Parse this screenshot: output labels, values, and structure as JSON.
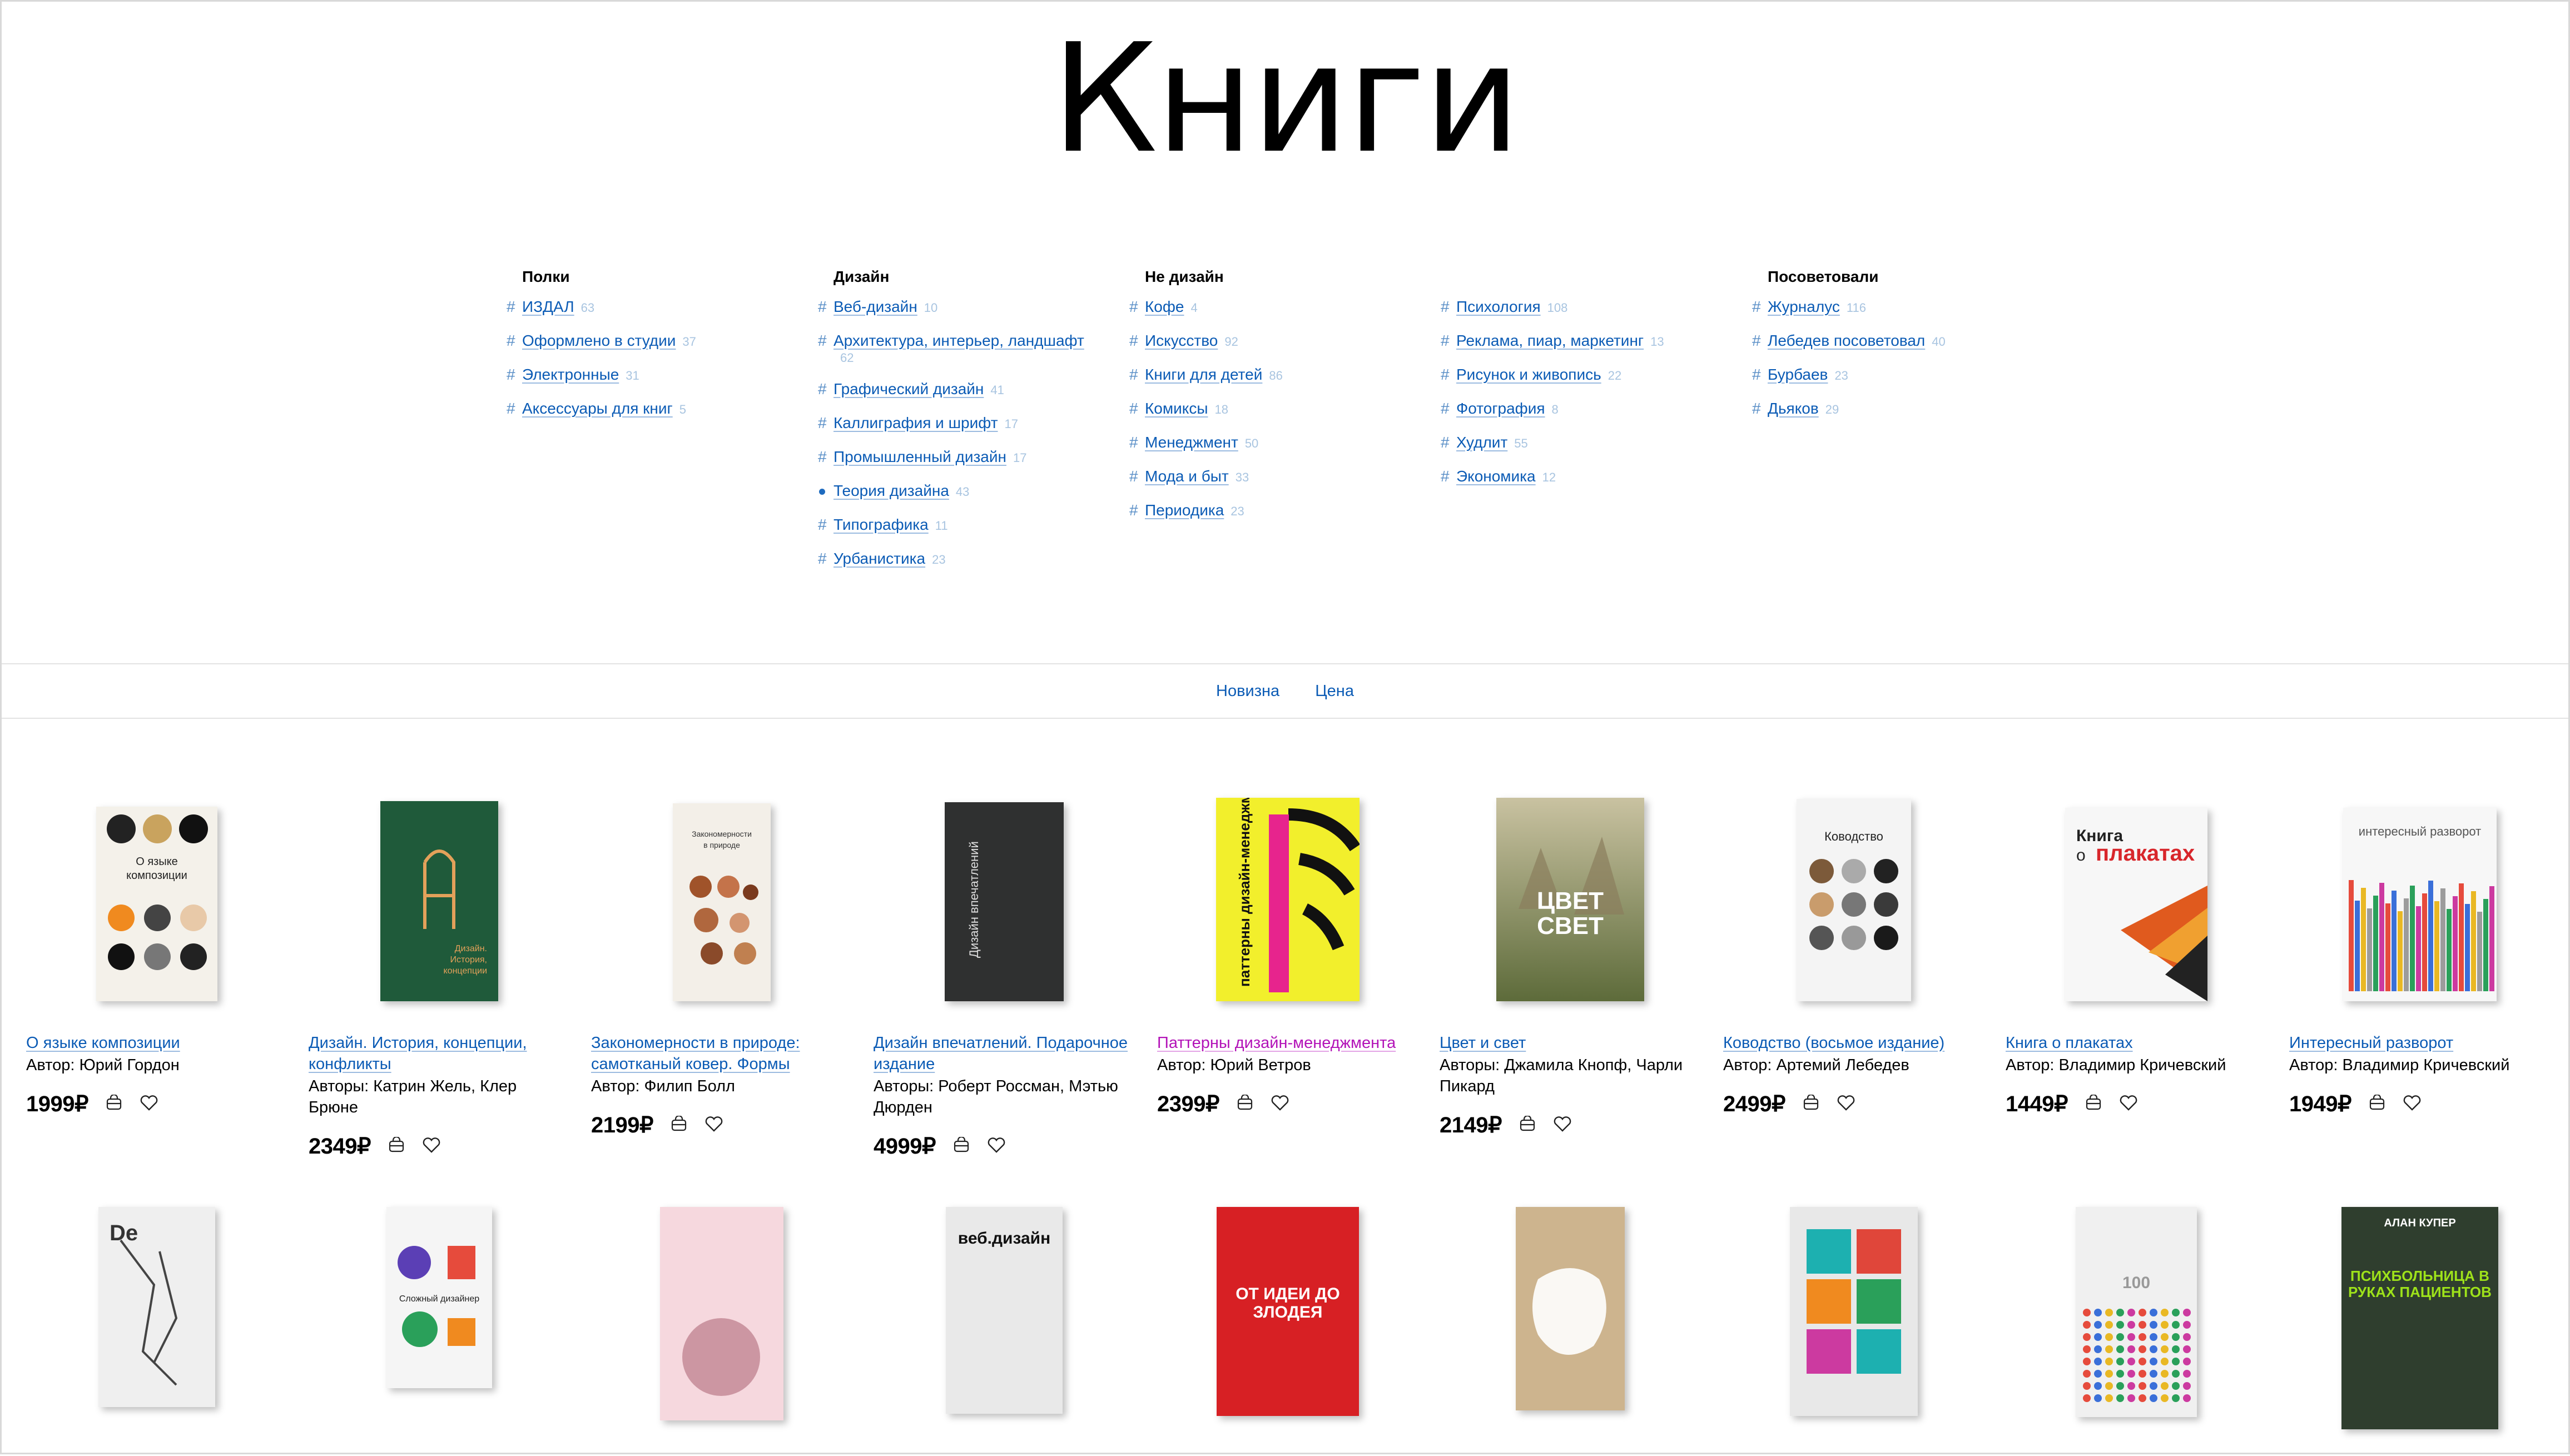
{
  "page": {
    "title": "Книги"
  },
  "categories": [
    {
      "heading": "Полки",
      "items": [
        {
          "label": "ИЗДАЛ",
          "count": "63"
        },
        {
          "label": "Оформлено в студии",
          "count": "37"
        },
        {
          "label": "Электронные",
          "count": "31"
        },
        {
          "label": "Аксессуары для книг",
          "count": "5"
        }
      ]
    },
    {
      "heading": "Дизайн",
      "items": [
        {
          "label": "Веб-дизайн",
          "count": "10"
        },
        {
          "label": "Архитектура, интерьер, ландшафт",
          "count": "62"
        },
        {
          "label": "Графический дизайн",
          "count": "41"
        },
        {
          "label": "Каллиграфия и шрифт",
          "count": "17"
        },
        {
          "label": "Промышленный дизайн",
          "count": "17"
        },
        {
          "label": "Теория дизайна",
          "count": "43",
          "active": true
        },
        {
          "label": "Типографика",
          "count": "11"
        },
        {
          "label": "Урбанистика",
          "count": "23"
        }
      ]
    },
    {
      "heading": "Не дизайн",
      "items": [
        {
          "label": "Кофе",
          "count": "4"
        },
        {
          "label": "Искусство",
          "count": "92"
        },
        {
          "label": "Книги для детей",
          "count": "86"
        },
        {
          "label": "Комиксы",
          "count": "18"
        },
        {
          "label": "Менеджмент",
          "count": "50"
        },
        {
          "label": "Мода и быт",
          "count": "33"
        },
        {
          "label": "Периодика",
          "count": "23"
        }
      ]
    },
    {
      "heading": "",
      "items": [
        {
          "label": "Психология",
          "count": "108"
        },
        {
          "label": "Реклама, пиар, маркетинг",
          "count": "13"
        },
        {
          "label": "Рисунок и живопись",
          "count": "22"
        },
        {
          "label": "Фотография",
          "count": "8"
        },
        {
          "label": "Худлит",
          "count": "55"
        },
        {
          "label": "Экономика",
          "count": "12"
        }
      ]
    },
    {
      "heading": "Посоветовали",
      "items": [
        {
          "label": "Журналус",
          "count": "116"
        },
        {
          "label": "Лебедев посоветовал",
          "count": "40"
        },
        {
          "label": "Бурбаев",
          "count": "23"
        },
        {
          "label": "Дьяков",
          "count": "29"
        }
      ]
    }
  ],
  "sort": {
    "newest": "Новизна",
    "price": "Цена"
  },
  "products": [
    {
      "title": "О языке композиции",
      "author": "Автор: Юрий Гордон",
      "price": "1999₽",
      "cover_bg": "#f4f1ea",
      "cover_fg": "#222"
    },
    {
      "title": "Дизайн. История, концепции, конфликты",
      "author": "Авторы: Катрин Жель, Клер Брюне",
      "price": "2349₽",
      "cover_bg": "#1f5a3a",
      "cover_fg": "#e3a15a"
    },
    {
      "title": "Закономерности в природе: самотканый ковер. Формы",
      "author": "Автор: Филип Болл",
      "price": "2199₽",
      "cover_bg": "#f3efe8",
      "cover_fg": "#7a3a1e"
    },
    {
      "title": "Дизайн впечатлений. Подарочное издание",
      "author": "Авторы: Роберт Россман, Мэтью Дюрден",
      "price": "4999₽",
      "cover_bg": "#2f3030",
      "cover_fg": "#ddd"
    },
    {
      "title": "Паттерны дизайн-менеджмента",
      "author": "Автор: Юрий Ветров",
      "price": "2399₽",
      "cover_bg": "#f2ef2c",
      "cover_fg": "#111",
      "pink": true
    },
    {
      "title": "Цвет и свет",
      "author": "Авторы: Джамила Кнопф, Чарли Пикард",
      "price": "2149₽",
      "cover_bg": "#7b7a63",
      "cover_fg": "#fff"
    },
    {
      "title": "Ководство (восьмое издание)",
      "author": "Автор: Артемий Лебедев",
      "price": "2499₽",
      "cover_bg": "#f4f4f4",
      "cover_fg": "#222"
    },
    {
      "title": "Книга о плакатах",
      "author": "Автор: Владимир Кричевский",
      "price": "1449₽",
      "cover_bg": "#f7f7f7",
      "cover_fg": "#d8262b"
    },
    {
      "title": "Интересный разворот",
      "author": "Автор: Владимир Кричевский",
      "price": "1949₽",
      "cover_bg": "#f7f7f7",
      "cover_fg": "#c42"
    }
  ],
  "products_row2": [
    {
      "cover_bg": "#efefef",
      "cover_fg": "#222"
    },
    {
      "cover_bg": "#f5f5f5",
      "cover_fg": "#5b3fb5"
    },
    {
      "cover_bg": "#f6d8de",
      "cover_fg": "#c05a74"
    },
    {
      "cover_bg": "#e9e9e9",
      "cover_fg": "#111",
      "label": "веб.дизайн"
    },
    {
      "cover_bg": "#d72024",
      "cover_fg": "#fff",
      "label": "ОТ ИДЕИ ДО ЗЛОДЕЯ"
    },
    {
      "cover_bg": "#cdb48e",
      "cover_fg": "#fff"
    },
    {
      "cover_bg": "#e8e8e8",
      "cover_fg": "#e0463a"
    },
    {
      "cover_bg": "#f0f0f0",
      "cover_fg": "#999",
      "label": "100"
    },
    {
      "cover_bg": "#2f3e2e",
      "cover_fg": "#9ee21a",
      "label": "ПСИХБОЛЬНИЦА В РУКАХ ПАЦИЕНТОВ",
      "top_label": "АЛАН КУПЕР"
    }
  ]
}
